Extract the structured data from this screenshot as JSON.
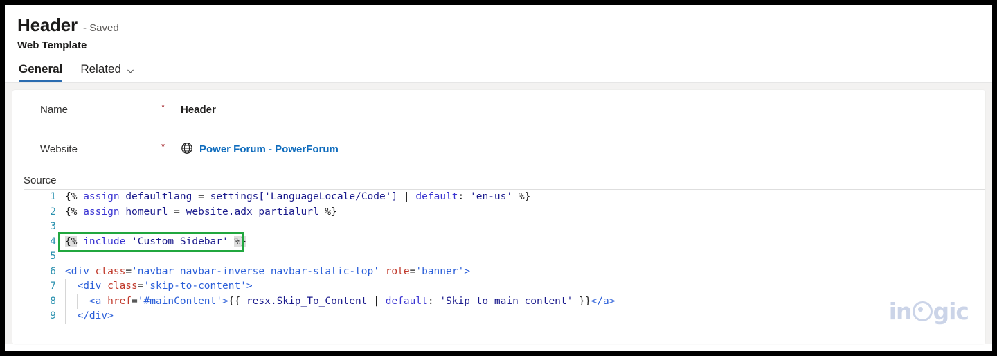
{
  "record": {
    "title": "Header",
    "state": "- Saved",
    "entity": "Web Template"
  },
  "tabs": [
    {
      "label": "General",
      "active": true,
      "icon": ""
    },
    {
      "label": "Related",
      "active": false,
      "icon": "chevron-down-icon"
    }
  ],
  "form": {
    "fields": [
      {
        "label": "Name",
        "required": "*",
        "value": "Header",
        "type": "text"
      },
      {
        "label": "Website",
        "required": "*",
        "value": "Power Forum - PowerForum",
        "type": "lookup",
        "icon": "globe-icon"
      }
    ],
    "source_label": "Source"
  },
  "editor": {
    "lines": [
      {
        "no": "1",
        "indent": 0,
        "tokens": [
          {
            "t": "{% ",
            "c": "t-plain"
          },
          {
            "t": "assign",
            "c": "t-kw"
          },
          {
            "t": " defaultlang ",
            "c": "t-var"
          },
          {
            "t": "= ",
            "c": "t-plain"
          },
          {
            "t": "settings[",
            "c": "t-var"
          },
          {
            "t": "'LanguageLocale/Code'",
            "c": "t-str"
          },
          {
            "t": "] ",
            "c": "t-var"
          },
          {
            "t": "| ",
            "c": "t-plain"
          },
          {
            "t": "default",
            "c": "t-kw"
          },
          {
            "t": ": ",
            "c": "t-plain"
          },
          {
            "t": "'en-us'",
            "c": "t-str"
          },
          {
            "t": " %}",
            "c": "t-plain"
          }
        ]
      },
      {
        "no": "2",
        "indent": 0,
        "tokens": [
          {
            "t": "{% ",
            "c": "t-plain"
          },
          {
            "t": "assign",
            "c": "t-kw"
          },
          {
            "t": " homeurl ",
            "c": "t-var"
          },
          {
            "t": "= ",
            "c": "t-plain"
          },
          {
            "t": "website.adx_partialurl",
            "c": "t-var"
          },
          {
            "t": " %}",
            "c": "t-plain"
          }
        ]
      },
      {
        "no": "3",
        "indent": 0,
        "tokens": []
      },
      {
        "no": "4",
        "indent": 0,
        "highlight": true,
        "tokens": [
          {
            "t": "{%",
            "c": "t-plain t-brkt"
          },
          {
            "t": " ",
            "c": "t-plain"
          },
          {
            "t": "include",
            "c": "t-kw"
          },
          {
            "t": " ",
            "c": "t-plain"
          },
          {
            "t": "'Custom Sidebar'",
            "c": "t-str"
          },
          {
            "t": " ",
            "c": "t-plain"
          },
          {
            "t": "%}",
            "c": "t-plain t-brkt"
          }
        ]
      },
      {
        "no": "5",
        "indent": 0,
        "tokens": []
      },
      {
        "no": "6",
        "indent": 0,
        "tokens": [
          {
            "t": "<div ",
            "c": "t-tag"
          },
          {
            "t": "class",
            "c": "t-attr"
          },
          {
            "t": "=",
            "c": "t-plain"
          },
          {
            "t": "'navbar navbar-inverse navbar-static-top'",
            "c": "t-attrval"
          },
          {
            "t": " ",
            "c": "t-plain"
          },
          {
            "t": "role",
            "c": "t-attr"
          },
          {
            "t": "=",
            "c": "t-plain"
          },
          {
            "t": "'banner'",
            "c": "t-attrval"
          },
          {
            "t": ">",
            "c": "t-tag"
          }
        ]
      },
      {
        "no": "7",
        "indent": 1,
        "tokens": [
          {
            "t": "  <div ",
            "c": "t-tag"
          },
          {
            "t": "class",
            "c": "t-attr"
          },
          {
            "t": "=",
            "c": "t-plain"
          },
          {
            "t": "'skip-to-content'",
            "c": "t-attrval"
          },
          {
            "t": ">",
            "c": "t-tag"
          }
        ]
      },
      {
        "no": "8",
        "indent": 2,
        "tokens": [
          {
            "t": "    <a ",
            "c": "t-tag"
          },
          {
            "t": "href",
            "c": "t-attr"
          },
          {
            "t": "=",
            "c": "t-plain"
          },
          {
            "t": "'#mainContent'",
            "c": "t-attrval"
          },
          {
            "t": ">",
            "c": "t-tag"
          },
          {
            "t": "{{ ",
            "c": "t-plain"
          },
          {
            "t": "resx.Skip_To_Content",
            "c": "t-var"
          },
          {
            "t": " | ",
            "c": "t-plain"
          },
          {
            "t": "default",
            "c": "t-kw"
          },
          {
            "t": ": ",
            "c": "t-plain"
          },
          {
            "t": "'Skip to main content'",
            "c": "t-str"
          },
          {
            "t": " }}",
            "c": "t-plain"
          },
          {
            "t": "</a>",
            "c": "t-tag"
          }
        ]
      },
      {
        "no": "9",
        "indent": 1,
        "tokens": [
          {
            "t": "  </div>",
            "c": "t-tag"
          }
        ]
      }
    ]
  },
  "watermark": {
    "pre": "in",
    "post": "gic"
  },
  "colors": {
    "accent": "#2b6cb0",
    "link": "#0f6cbd",
    "required": "#a4262c",
    "highlight_box": "#21a73f",
    "line_number": "#2b91af",
    "watermark": "#c3cde4"
  }
}
